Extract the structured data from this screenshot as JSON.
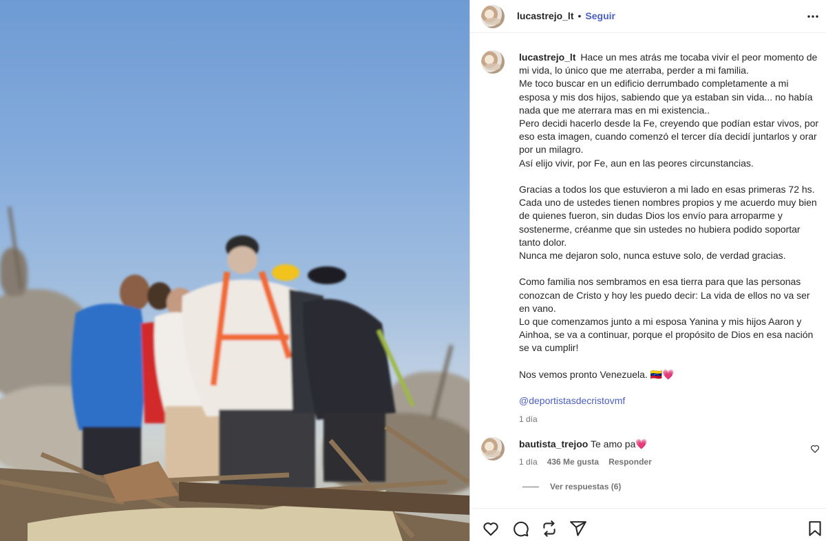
{
  "post": {
    "username": "lucastrejo_lt",
    "separator": "•",
    "follow_label": "Seguir",
    "more_icon": "more-horizontal-icon"
  },
  "caption": {
    "username": "lucastrejo_lt",
    "paragraphs": [
      "Hace un mes atrás me tocaba vivir el peor momento de mi vida, lo único que me aterraba, perder a mi familia.",
      "Me toco buscar en un edificio derrumbado completamente a mi esposa y mis dos hijos, sabiendo que ya estaban sin vida... no había nada que me aterrara mas en mi existencia..",
      "Pero decidi hacerlo desde la Fe, creyendo que podían estar vivos, por eso esta imagen, cuando comenzó el tercer día decidí juntarlos y orar por un milagro.",
      "Así elijo vivir, por Fe, aun en las peores circunstancias.",
      "",
      "Gracias a todos los que estuvieron a mi lado en esas primeras 72 hs. Cada uno de ustedes tienen nombres propios y me acuerdo muy bien de quienes fueron, sin dudas Dios los envío para arroparme y sostenerme, créanme que sin ustedes no hubiera podido soportar tanto dolor.",
      "Nunca me dejaron solo, nunca estuve solo, de verdad gracias.",
      "",
      "Como familia nos sembramos en esa tierra para que las personas conozcan de Cristo y hoy les puedo decir: La vida de ellos no va ser en vano.",
      "Lo que comenzamos junto a mi esposa Yanina y mis hijos Aaron y Ainhoa, se va a continuar, porque el propósito de Dios en esa nación se va cumplir!",
      "",
      "Nos vemos pronto Venezuela. 🇻🇪💗",
      "",
      "@deportistasdecristovmf"
    ],
    "timestamp": "1 día"
  },
  "comment": {
    "username": "bautista_trejoo",
    "text": "Te amo pa💗",
    "time": "1 día",
    "likes": "436 Me gusta",
    "reply_label": "Responder",
    "view_replies": "Ver respuestas (6)"
  },
  "actions": {
    "like_icon": "heart-icon",
    "comment_icon": "comment-icon",
    "share_icon": "repost-icon",
    "send_icon": "send-icon",
    "save_icon": "bookmark-icon"
  },
  "colors": {
    "link": "#4a5fc1",
    "text": "#262626",
    "muted": "#737373",
    "heart": "#e8417a"
  }
}
